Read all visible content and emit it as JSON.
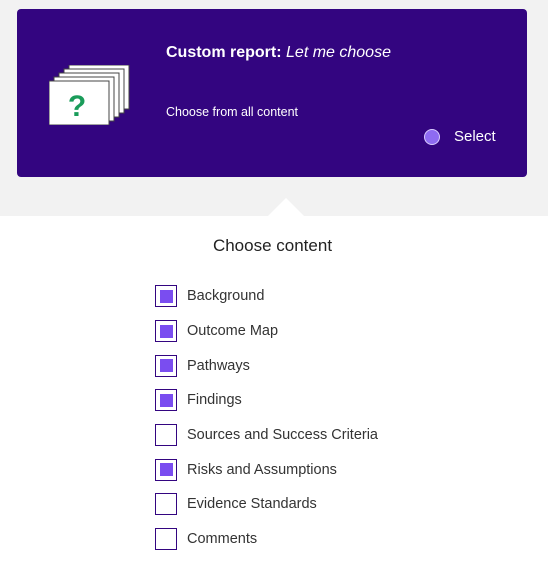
{
  "report_card": {
    "title_bold": "Custom report:",
    "title_italic": "Let me choose",
    "subtitle": "Choose from all content",
    "select_label": "Select",
    "icon_glyph": "?",
    "background_color": "#330580",
    "radio_color": "#8e6bf2"
  },
  "content_section": {
    "title": "Choose content",
    "accent_color": "#7a4df0",
    "items": [
      {
        "label": "Background",
        "checked": true
      },
      {
        "label": "Outcome Map",
        "checked": true
      },
      {
        "label": "Pathways",
        "checked": true
      },
      {
        "label": "Findings",
        "checked": true
      },
      {
        "label": "Sources and Success Criteria",
        "checked": false
      },
      {
        "label": "Risks and Assumptions",
        "checked": true
      },
      {
        "label": "Evidence Standards",
        "checked": false
      },
      {
        "label": "Comments",
        "checked": false
      }
    ]
  }
}
